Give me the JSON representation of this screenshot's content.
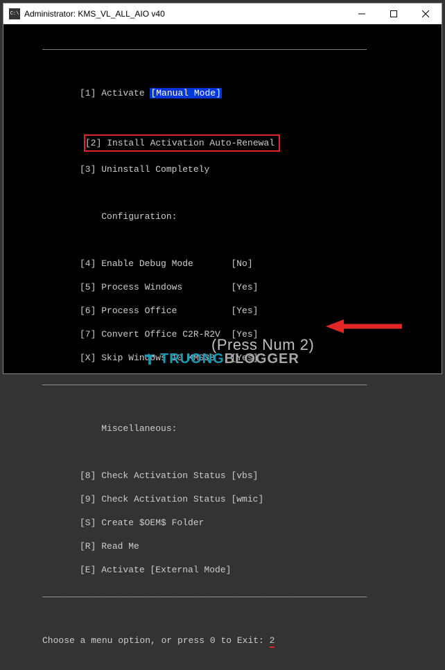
{
  "titlebar": {
    "icon_label": "C:\\",
    "title": "Administrator:  KMS_VL_ALL_AIO v40"
  },
  "divider": "____________________________________________________________",
  "menu": {
    "item1": {
      "key": "[1]",
      "label": "Activate",
      "mode": "[Manual Mode]"
    },
    "item2": {
      "full": "[2] Install Activation Auto-Renewal"
    },
    "item3": {
      "key": "[3]",
      "label": "Uninstall Completely"
    },
    "section_config": "Configuration:",
    "item4": {
      "key": "[4]",
      "label": "Enable Debug Mode",
      "status": "[No]"
    },
    "item5": {
      "key": "[5]",
      "label": "Process Windows",
      "status": "[Yes]"
    },
    "item6": {
      "key": "[6]",
      "label": "Process Office",
      "status": "[Yes]"
    },
    "item7": {
      "key": "[7]",
      "label": "Convert Office C2R-R2V",
      "status": "[Yes]"
    },
    "itemX": {
      "key": "[X]",
      "label": "Skip Windows 10 KMS38",
      "status": "[Yes]"
    },
    "section_misc": "Miscellaneous:",
    "item8": {
      "key": "[8]",
      "label": "Check Activation Status [vbs]"
    },
    "item9": {
      "key": "[9]",
      "label": "Check Activation Status [wmic]"
    },
    "itemS": {
      "key": "[S]",
      "label": "Create $OEM$ Folder"
    },
    "itemR": {
      "key": "[R]",
      "label": "Read Me"
    },
    "itemE": {
      "key": "[E]",
      "label": "Activate [External Mode]"
    }
  },
  "prompt": {
    "text": "Choose a menu option, or press 0 to Exit: ",
    "value": "2"
  },
  "hint": "(Press Num 2)",
  "watermark": {
    "part1": "TRUONG",
    "part2": "BLOGGER"
  }
}
